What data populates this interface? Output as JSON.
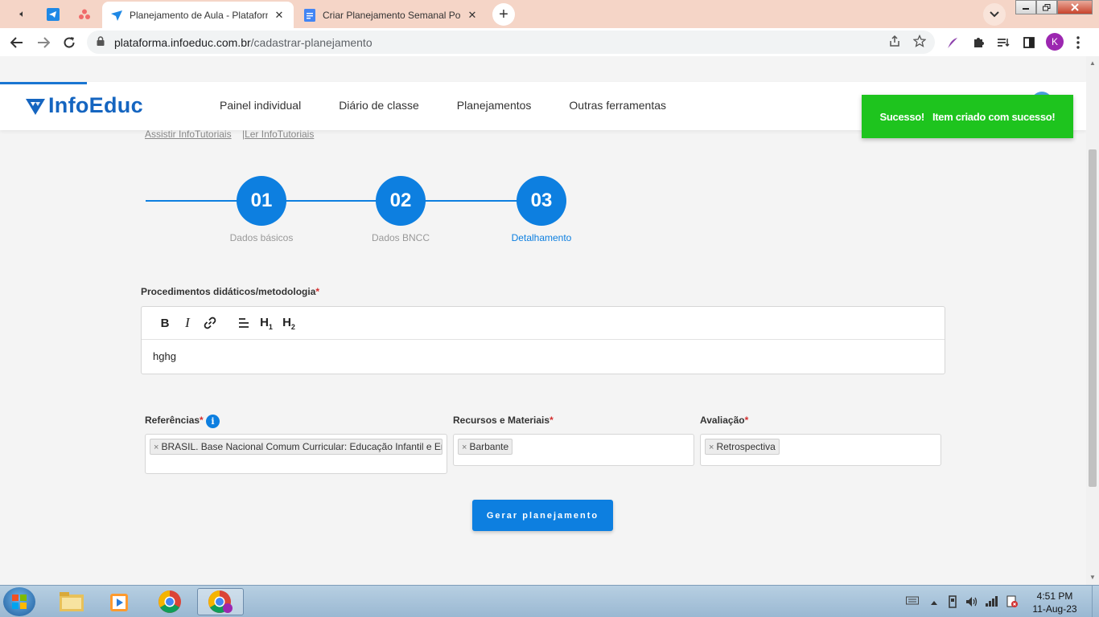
{
  "browser": {
    "tabs": [
      {
        "title": "Planejamento de Aula - Plataforma",
        "active": true
      },
      {
        "title": "Criar Planejamento Semanal Por Tema",
        "active": false
      }
    ],
    "close_glyph": "✕",
    "new_tab_glyph": "+",
    "url_host": "plataforma.infoeduc.com.br",
    "url_path": "/cadastrar-planejamento",
    "profile_initial": "K"
  },
  "header": {
    "logo_text": "InfoEduc",
    "nav": [
      "Painel individual",
      "Diário de classe",
      "Planejamentos",
      "Outras ferramentas"
    ]
  },
  "toast": {
    "title": "Sucesso!",
    "message": "Item criado com sucesso!",
    "color": "#1ec41e"
  },
  "tutorials": {
    "watch": "Assistir InfoTutoriais",
    "separator": "|",
    "read": "Ler InfoTutoriais"
  },
  "stepper": {
    "steps": [
      {
        "number": "01",
        "label": "Dados básicos"
      },
      {
        "number": "02",
        "label": "Dados BNCC"
      },
      {
        "number": "03",
        "label": "Detalhamento"
      }
    ],
    "current_step": 3,
    "color": "#0d7fe0"
  },
  "form": {
    "procedimentos": {
      "label": "Procedimentos didáticos/metodologia",
      "required_mark": "*",
      "content": "hghg",
      "tools": [
        "bold-icon",
        "italic-icon",
        "link-icon",
        "align-icon",
        "heading-1-icon",
        "heading-2-icon"
      ]
    },
    "referencias": {
      "label": "Referências",
      "required_mark": "*",
      "info_glyph": "i",
      "tags": [
        "BRASIL. Base Nacional Comum Curricular: Educação Infantil e Ensino Fundamental"
      ]
    },
    "recursos": {
      "label": "Recursos e Materiais",
      "required_mark": "*",
      "tags": [
        "Barbante"
      ]
    },
    "avaliacao": {
      "label": "Avaliação",
      "required_mark": "*",
      "tags": [
        "Retrospectiva"
      ]
    },
    "tag_remove_glyph": "×",
    "submit_label": "Gerar planejamento"
  },
  "taskbar": {
    "time": "4:51 PM",
    "date": "11-Aug-23"
  }
}
